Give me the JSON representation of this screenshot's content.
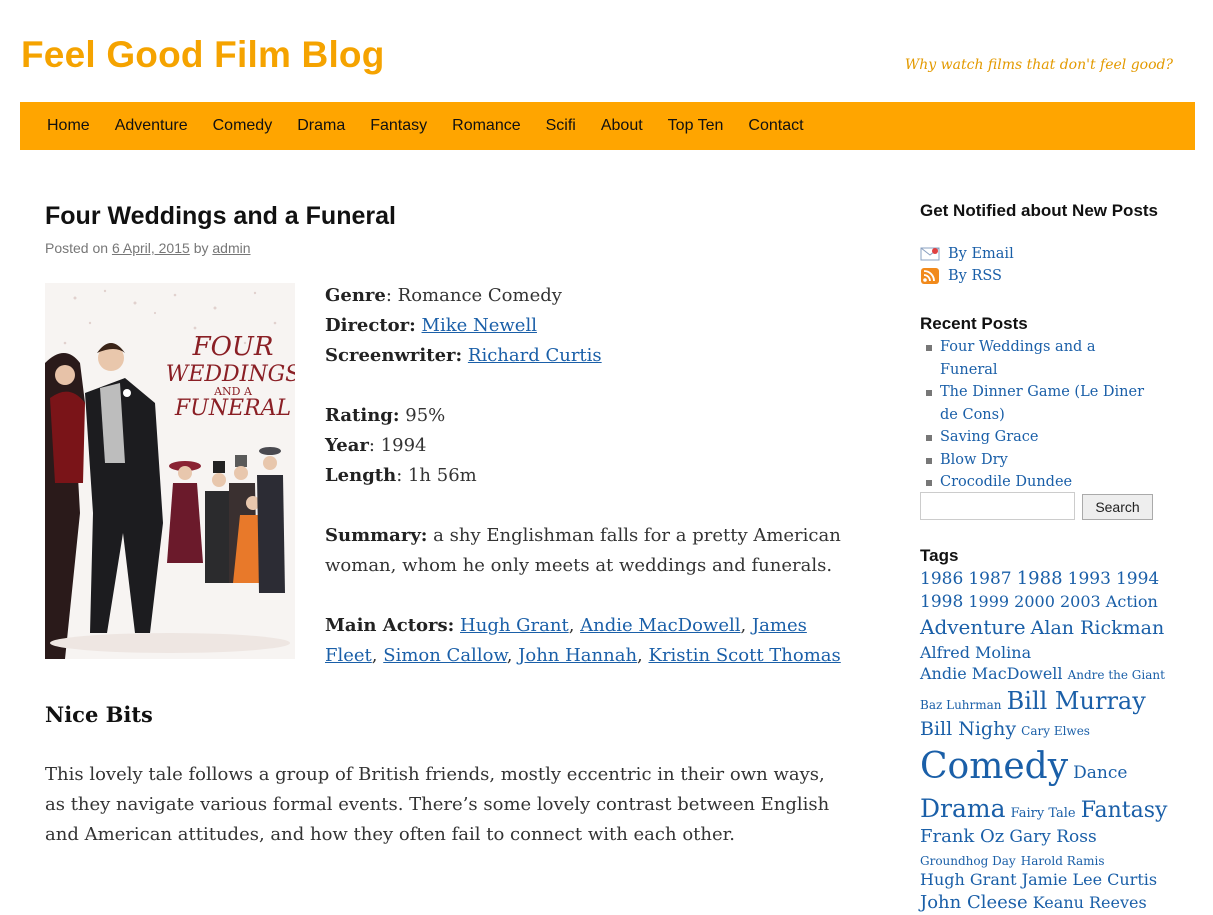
{
  "site": {
    "title": "Feel Good Film Blog",
    "tagline": "Why watch films that don't feel good?"
  },
  "nav": [
    "Home",
    "Adventure",
    "Comedy",
    "Drama",
    "Fantasy",
    "Romance",
    "Scifi",
    "About",
    "Top Ten",
    "Contact"
  ],
  "post": {
    "title": "Four Weddings and a Funeral",
    "meta": {
      "posted_on": "Posted on",
      "date": "6 April, 2015",
      "by": "by",
      "author": "admin"
    },
    "poster": {
      "line1": "FOUR",
      "line2": "WEDDINGS",
      "line3": "AND A",
      "line4": "FUNERAL"
    },
    "genre_label": "Genre",
    "genre": "Romance Comedy",
    "director_label": "Director:",
    "director": "Mike Newell",
    "writer_label": "Screenwriter:",
    "writer": "Richard Curtis",
    "rating_label": "Rating:",
    "rating": "95%",
    "year_label": "Year",
    "year": "1994",
    "length_label": "Length",
    "length": "1h 56m",
    "summary_label": "Summary:",
    "summary": "a shy Englishman falls for a pretty American woman, whom he only meets at weddings and funerals.",
    "actors_label": "Main Actors:",
    "actors": [
      "Hugh Grant",
      "Andie MacDowell",
      "James Fleet",
      "Simon Callow",
      "John Hannah",
      "Kristin Scott Thomas"
    ],
    "nice_bits_heading": "Nice Bits",
    "paragraph": "This lovely tale follows a group of British friends, mostly eccentric in their own ways, as they navigate various formal events. There’s some lovely contrast between English and American attitudes, and how they often fail to connect with each other."
  },
  "sidebar": {
    "notify_title": "Get Notified about New Posts",
    "by_email": "By Email",
    "by_rss": "By RSS",
    "recent_title": "Recent Posts",
    "recent": [
      "Four Weddings and a Funeral",
      "The Dinner Game (Le Diner de Cons)",
      "Saving Grace",
      "Blow Dry",
      "Crocodile Dundee"
    ],
    "search_button": "Search",
    "search_value": "",
    "tags_title": "Tags",
    "tags": [
      {
        "t": "1986",
        "s": 17
      },
      {
        "t": "1987",
        "s": 17
      },
      {
        "t": "1988",
        "s": 18
      },
      {
        "t": "1993",
        "s": 17
      },
      {
        "t": "1994",
        "s": 17
      },
      {
        "t": "1998",
        "s": 17
      },
      {
        "t": "1999",
        "s": 16
      },
      {
        "t": "2000",
        "s": 16
      },
      {
        "t": "2003",
        "s": 16
      },
      {
        "t": "Action",
        "s": 16
      },
      {
        "t": "Adventure",
        "s": 20
      },
      {
        "t": "Alan Rickman",
        "s": 19
      },
      {
        "t": "Alfred Molina",
        "s": 16
      },
      {
        "t": "Andie MacDowell",
        "s": 16
      },
      {
        "t": "Andre the Giant",
        "s": 12
      },
      {
        "t": "Baz Luhrman",
        "s": 12
      },
      {
        "t": "Bill Murray",
        "s": 24
      },
      {
        "t": "Bill Nighy",
        "s": 19
      },
      {
        "t": "Cary Elwes",
        "s": 12
      },
      {
        "t": "Comedy",
        "s": 36
      },
      {
        "t": "Dance",
        "s": 17
      },
      {
        "t": "Drama",
        "s": 25
      },
      {
        "t": "Fairy Tale",
        "s": 13
      },
      {
        "t": "Fantasy",
        "s": 22
      },
      {
        "t": "Frank Oz",
        "s": 18
      },
      {
        "t": "Gary Ross",
        "s": 17
      },
      {
        "t": "Groundhog Day",
        "s": 12
      },
      {
        "t": "Harold Ramis",
        "s": 12
      },
      {
        "t": "Hugh Grant",
        "s": 16
      },
      {
        "t": "Jamie Lee Curtis",
        "s": 16
      },
      {
        "t": "John Cleese",
        "s": 18
      },
      {
        "t": "Keanu Reeves",
        "s": 16
      }
    ]
  },
  "colors": {
    "brand": "#ffa500",
    "title": "#f5a300",
    "link": "#1a5fa8"
  }
}
